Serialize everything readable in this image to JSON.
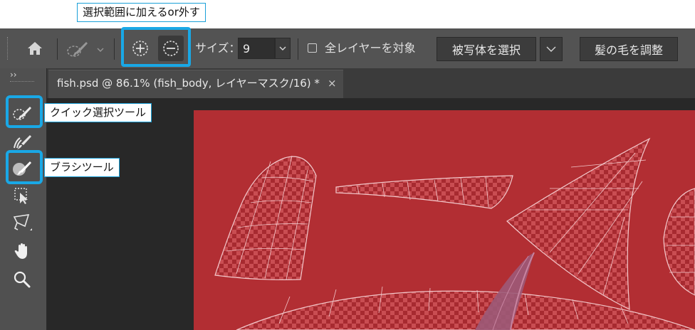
{
  "annotations": {
    "top": "選択範囲に加えるor外す",
    "quick_select": "クイック選択ツール",
    "brush": "ブラシツール"
  },
  "options_bar": {
    "size_label": "サイズ：",
    "size_value": "9",
    "all_layers_label": "全レイヤーを対象",
    "select_subject": "被写体を選択",
    "refine_hair": "髪の毛を調整"
  },
  "document_tab": {
    "title": "fish.psd @ 86.1% (fish_body, レイヤーマスク/16) *",
    "close": "×"
  },
  "toolbar": {
    "collapse": "››"
  },
  "colors": {
    "highlight": "#19a8e6",
    "canvas_red": "#b22e33",
    "ui_dark": "#535353"
  }
}
